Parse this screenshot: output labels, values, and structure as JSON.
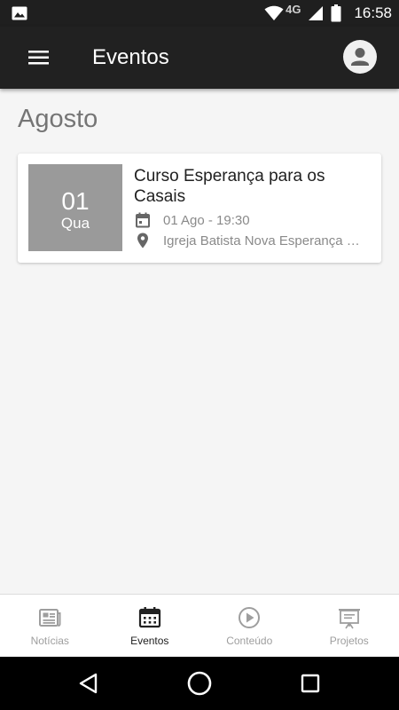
{
  "status_bar": {
    "network": "4G",
    "time": "16:58"
  },
  "app_bar": {
    "title": "Eventos"
  },
  "month": "Agosto",
  "events": [
    {
      "day": "01",
      "weekday": "Qua",
      "title": "Curso Esperança para os Casais",
      "datetime": "01 Ago - 19:30",
      "location": "Igreja Batista Nova Esperança C..."
    }
  ],
  "bottom_nav": {
    "items": [
      {
        "label": "Notícias",
        "icon": "newspaper-icon"
      },
      {
        "label": "Eventos",
        "icon": "calendar-icon",
        "active": true
      },
      {
        "label": "Conteúdo",
        "icon": "play-circle-icon"
      },
      {
        "label": "Projetos",
        "icon": "presentation-icon"
      }
    ]
  }
}
